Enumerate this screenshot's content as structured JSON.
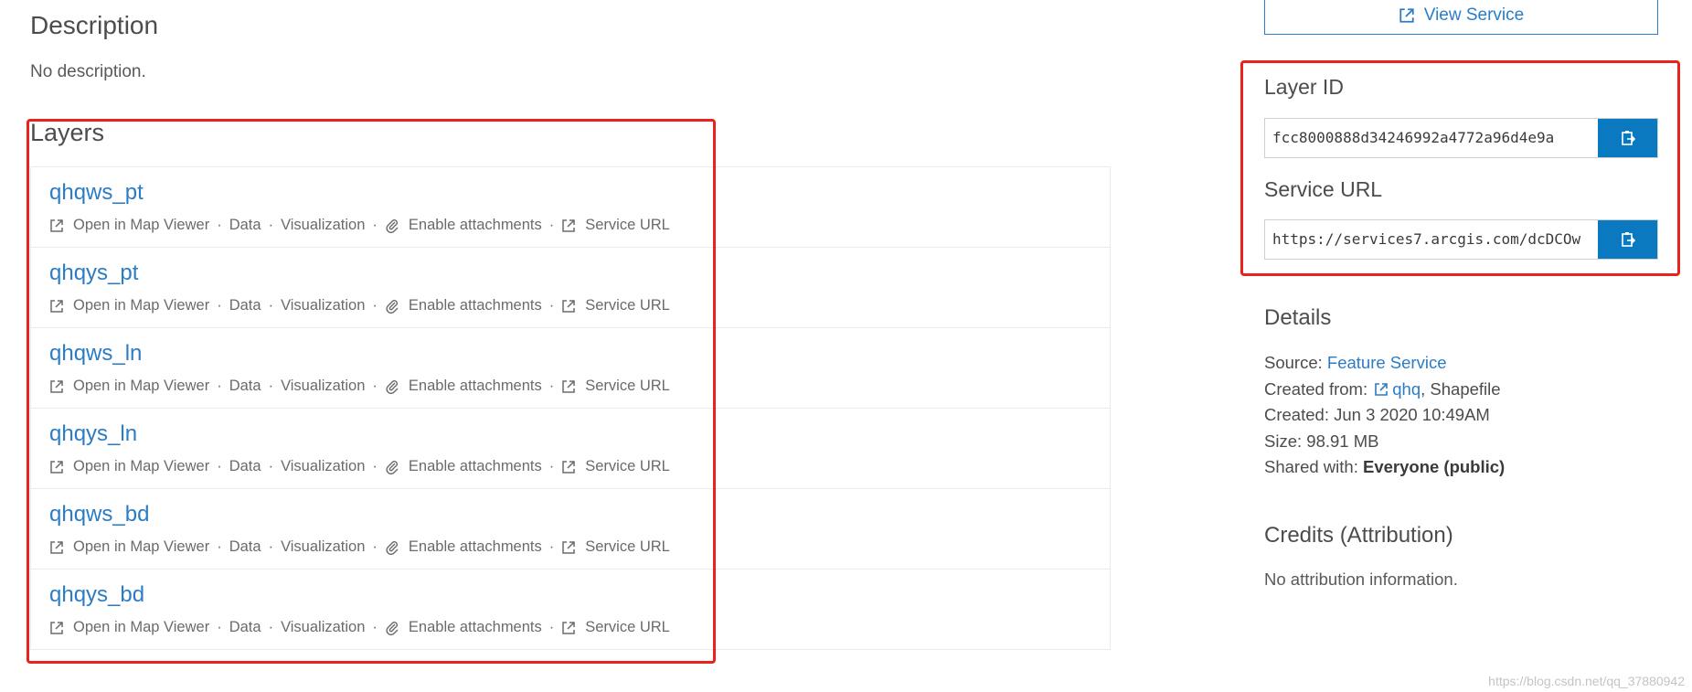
{
  "description": {
    "title": "Description",
    "text": "No description."
  },
  "layers": {
    "title": "Layers",
    "action_labels": {
      "open_map_viewer": "Open in Map Viewer",
      "data": "Data",
      "visualization": "Visualization",
      "enable_attachments": "Enable attachments",
      "service_url": "Service URL",
      "separator": "·"
    },
    "items": [
      {
        "name": "qhqws_pt"
      },
      {
        "name": "qhqys_pt"
      },
      {
        "name": "qhqws_ln"
      },
      {
        "name": "qhqys_ln"
      },
      {
        "name": "qhqws_bd"
      },
      {
        "name": "qhqys_bd"
      }
    ]
  },
  "sidebar": {
    "view_service_label": "View Service",
    "layer_id": {
      "label": "Layer ID",
      "value": "fcc8000888d34246992a4772a96d4e9a"
    },
    "service_url": {
      "label": "Service URL",
      "value": "https://services7.arcgis.com/dcDCOw"
    },
    "details": {
      "title": "Details",
      "source_label": "Source:",
      "source_value": "Feature Service",
      "created_from_label": "Created from:",
      "created_from_link": "qhq",
      "created_from_suffix": ", Shapefile",
      "created_label": "Created:",
      "created_value": "Jun 3 2020 10:49AM",
      "size_label": "Size:",
      "size_value": "98.91 MB",
      "shared_label": "Shared with:",
      "shared_value": "Everyone (public)"
    },
    "credits": {
      "title": "Credits (Attribution)",
      "text": "No attribution information."
    }
  },
  "watermark": "https://blog.csdn.net/qq_37880942",
  "colors": {
    "link": "#2b7cc7",
    "primary_button": "#0a79bf",
    "highlight_box": "#e8231e"
  },
  "icons": {
    "open_link": "external-link-icon",
    "attachment": "paperclip-icon",
    "copy": "clipboard-copy-icon"
  }
}
